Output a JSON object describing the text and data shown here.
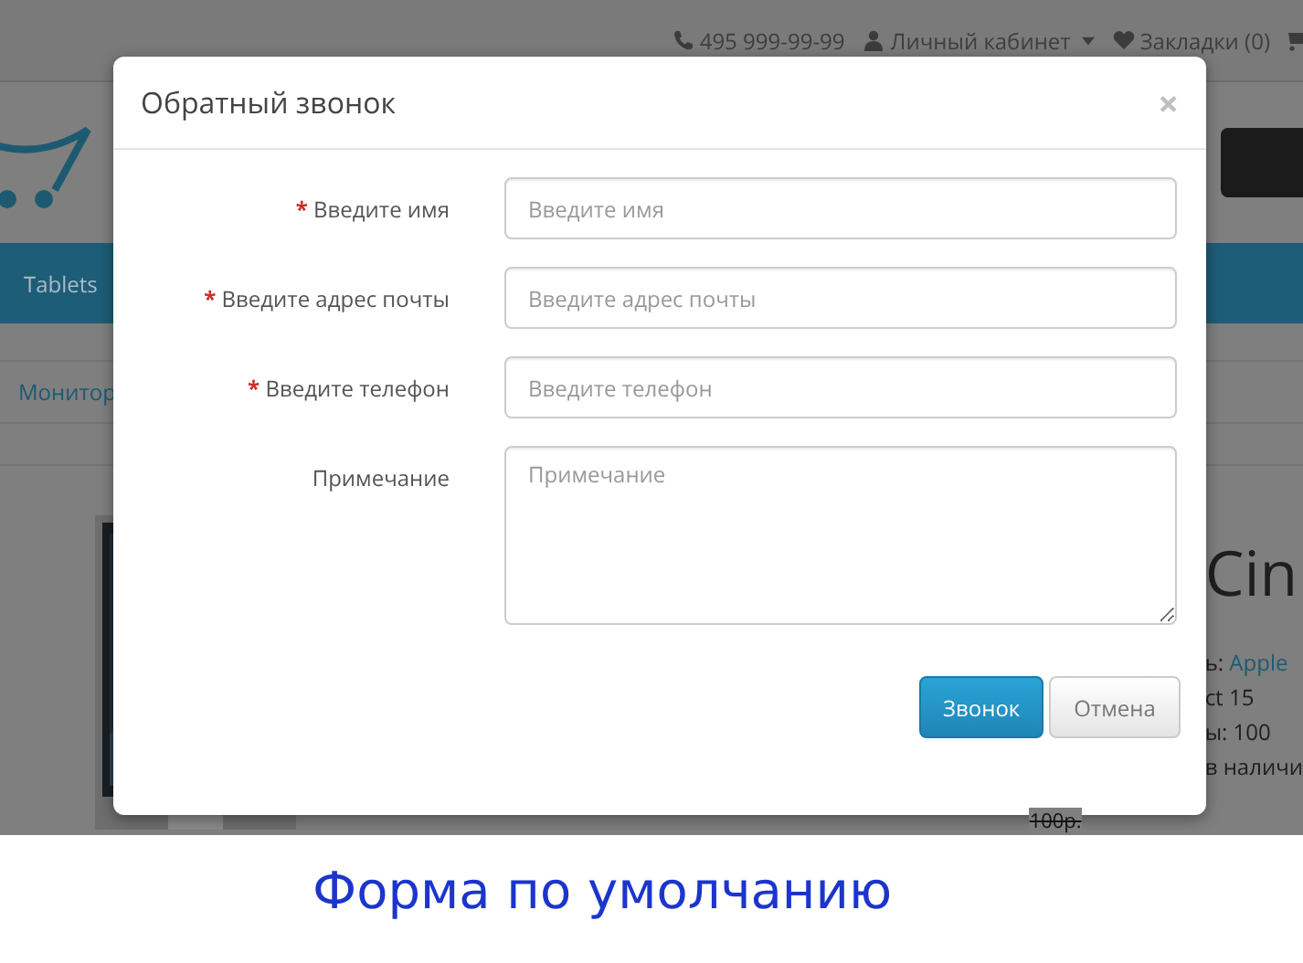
{
  "top_bar": {
    "phone": "495 999-99-99",
    "account": "Личный кабинет",
    "wishlist": "Закладки (0)"
  },
  "menu": {
    "items": [
      "Tablets"
    ]
  },
  "breadcrumb": [
    "Монитор"
  ],
  "product": {
    "title": "Cin",
    "details": [
      {
        "text": "ь: ",
        "link": "Apple"
      },
      {
        "text": "ct 15"
      },
      {
        "text": "ы: 100"
      },
      {
        "text": "в наличи"
      }
    ],
    "old_price": "100р."
  },
  "modal": {
    "title": "Обратный звонок",
    "close": "×",
    "required_mark": "*",
    "fields": [
      {
        "kind": "input",
        "label": "Введите имя",
        "required": true,
        "placeholder": "Введите имя"
      },
      {
        "kind": "input",
        "label": "Введите адрес почты",
        "required": true,
        "placeholder": "Введите адрес почты"
      },
      {
        "kind": "input",
        "label": "Введите телефон",
        "required": true,
        "placeholder": "Введите телефон"
      },
      {
        "kind": "textarea",
        "label": "Примечание",
        "required": false,
        "placeholder": "Примечание"
      }
    ],
    "buttons": [
      {
        "kind": "primary",
        "label": "Звонок"
      },
      {
        "kind": "default",
        "label": "Отмена"
      }
    ]
  },
  "caption": "Форма по умолчанию"
}
